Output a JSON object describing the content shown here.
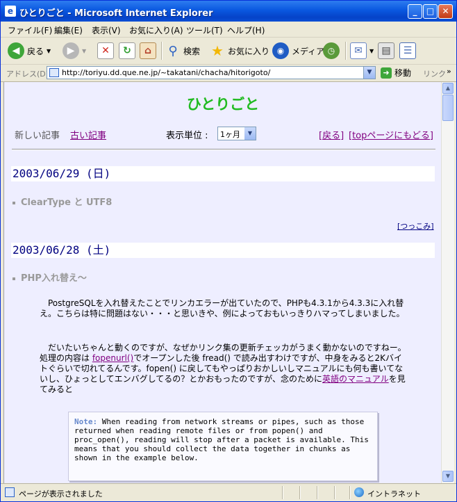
{
  "window": {
    "title": "ひとりごと - Microsoft Internet Explorer"
  },
  "menu": [
    "ファイル(F)",
    "編集(E)",
    "表示(V)",
    "お気に入り(A)",
    "ツール(T)",
    "ヘルプ(H)"
  ],
  "toolbar": {
    "back": "戻る",
    "search": "検索",
    "favorites": "お気に入り",
    "media": "メディア"
  },
  "address": {
    "label": "アドレス(D)",
    "url": "http://toriyu.dd.que.ne.jp/~takatani/chacha/hitorigoto/",
    "go": "移動",
    "links": "リンク",
    "links_chevron": "»"
  },
  "page": {
    "title": "ひとりごと",
    "nav": {
      "newer": "新しい記事",
      "older": "古い記事",
      "unit_label": "表示単位 :",
      "unit_value": "1ヶ月",
      "back": "[戻る]",
      "top": "[topページにもどる]"
    },
    "days": [
      {
        "date": "2003/06/29 (日)",
        "entries": [
          {
            "title": "ClearType と UTF8",
            "tsukkomi": "[つっこみ]"
          }
        ]
      },
      {
        "date": "2003/06/28 (土)",
        "entries": [
          {
            "title": "PHP入れ替え〜",
            "para1": "PostgreSQLを入れ替えたことでリンカエラーが出ていたので、PHPも4.3.1から4.3.3に入れ替え。こちらは特に問題はない・・・と思いきや、例によっておもいっきりハマってしまいました。",
            "para2_a": "だいたいちゃんと動くのですが、なぜかリンク集の更新チェッカがうまく動かないのですねー。処理の内容は ",
            "para2_link1": "fopenurl()",
            "para2_b": "でオープンした後 fread() で読み出すわけですが、中身をみると2Kバイトぐらいで切れてるんです。fopen() に戻してもやっぱりおかしいしマニュアルにも何も書いてないし、ひょっとしてエンバグしてるの？とかおもったのですが、念のために",
            "para2_link2": "英語のマニュアル",
            "para2_c": "を見てみると",
            "note_label": "Note:",
            "note_text": " When reading from network streams or pipes, such as those returned when reading remote files or from popen() and proc_open(), reading will stop after a packet is available. This means that you should collect the data together in chunks as shown in the example below."
          }
        ]
      }
    ]
  },
  "status": {
    "text": "ページが表示されました",
    "zone": "イントラネット"
  }
}
